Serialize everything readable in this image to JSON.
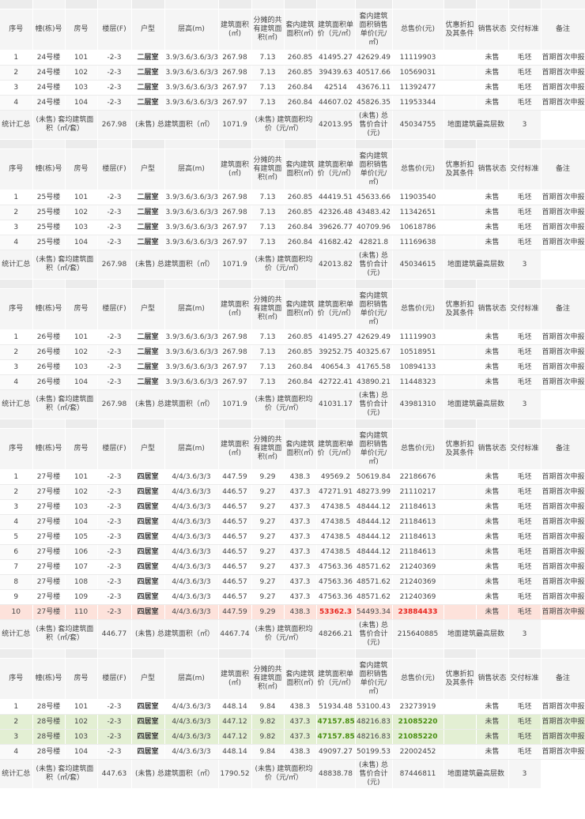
{
  "headers": [
    "序号",
    "幢(栋)号",
    "房号",
    "楼层(F)",
    "户型",
    "层高(m)",
    "建筑面积(㎡)",
    "分摊的共有建筑面积(㎡)",
    "套内建筑面积(㎡)",
    "建筑面积单价（元/㎡）",
    "套内建筑面积销售单价(元/㎡)",
    "总售价(元)",
    "优惠折扣及其条件",
    "销售状态",
    "交付标准",
    "备注"
  ],
  "summary_labels": {
    "title": "统计汇总",
    "avg_area": "(未售) 套均建筑面积（㎡/套）",
    "total_area": "(未售) 总建筑面积（㎡）",
    "avg_price": "(未售) 建筑面积均价（元/㎡）",
    "total_price": "(未售) 总售价合计(元)",
    "max_floors": "地面建筑最高层数"
  },
  "blocks": [
    {
      "rows": [
        {
          "no": "1",
          "bldg": "24号楼",
          "room": "101",
          "floor": "-2-3",
          "type": "二层室",
          "height": "3.9/3.6/3.6/3/3",
          "area": "267.98",
          "shared": "7.13",
          "inner": "260.85",
          "unit": "41495.27",
          "inner_unit": "42629.49",
          "total": "11119903",
          "discount": "",
          "status": "未售",
          "delivery": "毛坯",
          "note": "首期首次申报"
        },
        {
          "no": "2",
          "bldg": "24号楼",
          "room": "102",
          "floor": "-2-3",
          "type": "二层室",
          "height": "3.9/3.6/3.6/3/3",
          "area": "267.98",
          "shared": "7.13",
          "inner": "260.85",
          "unit": "39439.63",
          "inner_unit": "40517.66",
          "total": "10569031",
          "discount": "",
          "status": "未售",
          "delivery": "毛坯",
          "note": "首期首次申报"
        },
        {
          "no": "3",
          "bldg": "24号楼",
          "room": "103",
          "floor": "-2-3",
          "type": "二层室",
          "height": "3.9/3.6/3.6/3/3",
          "area": "267.97",
          "shared": "7.13",
          "inner": "260.84",
          "unit": "42514",
          "inner_unit": "43676.11",
          "total": "11392477",
          "discount": "",
          "status": "未售",
          "delivery": "毛坯",
          "note": "首期首次申报"
        },
        {
          "no": "4",
          "bldg": "24号楼",
          "room": "104",
          "floor": "-2-3",
          "type": "二层室",
          "height": "3.9/3.6/3.6/3/3",
          "area": "267.97",
          "shared": "7.13",
          "inner": "260.84",
          "unit": "44607.02",
          "inner_unit": "45826.35",
          "total": "11953344",
          "discount": "",
          "status": "未售",
          "delivery": "毛坯",
          "note": "首期首次申报"
        }
      ],
      "summary": {
        "avg_area": "267.98",
        "total_area": "1071.9",
        "avg_price": "42013.95",
        "total_price": "45034755",
        "max_floors": "3"
      }
    },
    {
      "rows": [
        {
          "no": "1",
          "bldg": "25号楼",
          "room": "101",
          "floor": "-2-3",
          "type": "二层室",
          "height": "3.9/3.6/3.6/3/3",
          "area": "267.98",
          "shared": "7.13",
          "inner": "260.85",
          "unit": "44419.51",
          "inner_unit": "45633.66",
          "total": "11903540",
          "discount": "",
          "status": "未售",
          "delivery": "毛坯",
          "note": "首期首次申报"
        },
        {
          "no": "2",
          "bldg": "25号楼",
          "room": "102",
          "floor": "-2-3",
          "type": "二层室",
          "height": "3.9/3.6/3.6/3/3",
          "area": "267.98",
          "shared": "7.13",
          "inner": "260.85",
          "unit": "42326.48",
          "inner_unit": "43483.42",
          "total": "11342651",
          "discount": "",
          "status": "未售",
          "delivery": "毛坯",
          "note": "首期首次申报"
        },
        {
          "no": "3",
          "bldg": "25号楼",
          "room": "103",
          "floor": "-2-3",
          "type": "二层室",
          "height": "3.9/3.6/3.6/3/3",
          "area": "267.97",
          "shared": "7.13",
          "inner": "260.84",
          "unit": "39626.77",
          "inner_unit": "40709.96",
          "total": "10618786",
          "discount": "",
          "status": "未售",
          "delivery": "毛坯",
          "note": "首期首次申报"
        },
        {
          "no": "4",
          "bldg": "25号楼",
          "room": "104",
          "floor": "-2-3",
          "type": "二层室",
          "height": "3.9/3.6/3.6/3/3",
          "area": "267.97",
          "shared": "7.13",
          "inner": "260.84",
          "unit": "41682.42",
          "inner_unit": "42821.8",
          "total": "11169638",
          "discount": "",
          "status": "未售",
          "delivery": "毛坯",
          "note": "首期首次申报"
        }
      ],
      "summary": {
        "avg_area": "267.98",
        "total_area": "1071.9",
        "avg_price": "42013.82",
        "total_price": "45034615",
        "max_floors": "3"
      }
    },
    {
      "rows": [
        {
          "no": "1",
          "bldg": "26号楼",
          "room": "101",
          "floor": "-2-3",
          "type": "二层室",
          "height": "3.9/3.6/3.6/3/3",
          "area": "267.98",
          "shared": "7.13",
          "inner": "260.85",
          "unit": "41495.27",
          "inner_unit": "42629.49",
          "total": "11119903",
          "discount": "",
          "status": "未售",
          "delivery": "毛坯",
          "note": "首期首次申报"
        },
        {
          "no": "2",
          "bldg": "26号楼",
          "room": "102",
          "floor": "-2-3",
          "type": "二层室",
          "height": "3.9/3.6/3.6/3/3",
          "area": "267.98",
          "shared": "7.13",
          "inner": "260.85",
          "unit": "39252.75",
          "inner_unit": "40325.67",
          "total": "10518951",
          "discount": "",
          "status": "未售",
          "delivery": "毛坯",
          "note": "首期首次申报"
        },
        {
          "no": "3",
          "bldg": "26号楼",
          "room": "103",
          "floor": "-2-3",
          "type": "二层室",
          "height": "3.9/3.6/3.6/3/3",
          "area": "267.97",
          "shared": "7.13",
          "inner": "260.84",
          "unit": "40654.3",
          "inner_unit": "41765.58",
          "total": "10894133",
          "discount": "",
          "status": "未售",
          "delivery": "毛坯",
          "note": "首期首次申报"
        },
        {
          "no": "4",
          "bldg": "26号楼",
          "room": "104",
          "floor": "-2-3",
          "type": "二层室",
          "height": "3.9/3.6/3.6/3/3",
          "area": "267.97",
          "shared": "7.13",
          "inner": "260.84",
          "unit": "42722.41",
          "inner_unit": "43890.21",
          "total": "11448323",
          "discount": "",
          "status": "未售",
          "delivery": "毛坯",
          "note": "首期首次申报"
        }
      ],
      "summary": {
        "avg_area": "267.98",
        "total_area": "1071.9",
        "avg_price": "41031.17",
        "total_price": "43981310",
        "max_floors": "3"
      }
    },
    {
      "rows": [
        {
          "no": "1",
          "bldg": "27号楼",
          "room": "101",
          "floor": "-2-3",
          "type": "四居室",
          "height": "4/4/3.6/3/3",
          "area": "447.59",
          "shared": "9.29",
          "inner": "438.3",
          "unit": "49569.2",
          "inner_unit": "50619.84",
          "total": "22186676",
          "discount": "",
          "status": "未售",
          "delivery": "毛坯",
          "note": "首期首次申报"
        },
        {
          "no": "2",
          "bldg": "27号楼",
          "room": "102",
          "floor": "-2-3",
          "type": "四居室",
          "height": "4/4/3.6/3/3",
          "area": "446.57",
          "shared": "9.27",
          "inner": "437.3",
          "unit": "47271.91",
          "inner_unit": "48273.99",
          "total": "21110217",
          "discount": "",
          "status": "未售",
          "delivery": "毛坯",
          "note": "首期首次申报"
        },
        {
          "no": "3",
          "bldg": "27号楼",
          "room": "103",
          "floor": "-2-3",
          "type": "四居室",
          "height": "4/4/3.6/3/3",
          "area": "446.57",
          "shared": "9.27",
          "inner": "437.3",
          "unit": "47438.5",
          "inner_unit": "48444.12",
          "total": "21184613",
          "discount": "",
          "status": "未售",
          "delivery": "毛坯",
          "note": "首期首次申报"
        },
        {
          "no": "4",
          "bldg": "27号楼",
          "room": "104",
          "floor": "-2-3",
          "type": "四居室",
          "height": "4/4/3.6/3/3",
          "area": "446.57",
          "shared": "9.27",
          "inner": "437.3",
          "unit": "47438.5",
          "inner_unit": "48444.12",
          "total": "21184613",
          "discount": "",
          "status": "未售",
          "delivery": "毛坯",
          "note": "首期首次申报"
        },
        {
          "no": "5",
          "bldg": "27号楼",
          "room": "105",
          "floor": "-2-3",
          "type": "四居室",
          "height": "4/4/3.6/3/3",
          "area": "446.57",
          "shared": "9.27",
          "inner": "437.3",
          "unit": "47438.5",
          "inner_unit": "48444.12",
          "total": "21184613",
          "discount": "",
          "status": "未售",
          "delivery": "毛坯",
          "note": "首期首次申报"
        },
        {
          "no": "6",
          "bldg": "27号楼",
          "room": "106",
          "floor": "-2-3",
          "type": "四居室",
          "height": "4/4/3.6/3/3",
          "area": "446.57",
          "shared": "9.27",
          "inner": "437.3",
          "unit": "47438.5",
          "inner_unit": "48444.12",
          "total": "21184613",
          "discount": "",
          "status": "未售",
          "delivery": "毛坯",
          "note": "首期首次申报"
        },
        {
          "no": "7",
          "bldg": "27号楼",
          "room": "107",
          "floor": "-2-3",
          "type": "四居室",
          "height": "4/4/3.6/3/3",
          "area": "446.57",
          "shared": "9.27",
          "inner": "437.3",
          "unit": "47563.36",
          "inner_unit": "48571.62",
          "total": "21240369",
          "discount": "",
          "status": "未售",
          "delivery": "毛坯",
          "note": "首期首次申报"
        },
        {
          "no": "8",
          "bldg": "27号楼",
          "room": "108",
          "floor": "-2-3",
          "type": "四居室",
          "height": "4/4/3.6/3/3",
          "area": "446.57",
          "shared": "9.27",
          "inner": "437.3",
          "unit": "47563.36",
          "inner_unit": "48571.62",
          "total": "21240369",
          "discount": "",
          "status": "未售",
          "delivery": "毛坯",
          "note": "首期首次申报"
        },
        {
          "no": "9",
          "bldg": "27号楼",
          "room": "109",
          "floor": "-2-3",
          "type": "四居室",
          "height": "4/4/3.6/3/3",
          "area": "446.57",
          "shared": "9.27",
          "inner": "437.3",
          "unit": "47563.36",
          "inner_unit": "48571.62",
          "total": "21240369",
          "discount": "",
          "status": "未售",
          "delivery": "毛坯",
          "note": "首期首次申报"
        },
        {
          "no": "10",
          "bldg": "27号楼",
          "room": "110",
          "floor": "-2-3",
          "type": "四居室",
          "height": "4/4/3.6/3/3",
          "area": "447.59",
          "shared": "9.29",
          "inner": "438.3",
          "unit": "53362.3",
          "inner_unit": "54493.34",
          "total": "23884433",
          "discount": "",
          "status": "未售",
          "delivery": "毛坯",
          "note": "首期首次申报",
          "highlight": "red"
        }
      ],
      "summary": {
        "avg_area": "446.77",
        "total_area": "4467.74",
        "avg_price": "48266.21",
        "total_price": "215640885",
        "max_floors": "3"
      }
    },
    {
      "rows": [
        {
          "no": "1",
          "bldg": "28号楼",
          "room": "101",
          "floor": "-2-3",
          "type": "四居室",
          "height": "4/4/3.6/3/3",
          "area": "448.14",
          "shared": "9.84",
          "inner": "438.3",
          "unit": "51934.48",
          "inner_unit": "53100.43",
          "total": "23273919",
          "discount": "",
          "status": "未售",
          "delivery": "毛坯",
          "note": "首期首次申报"
        },
        {
          "no": "2",
          "bldg": "28号楼",
          "room": "102",
          "floor": "-2-3",
          "type": "四居室",
          "height": "4/4/3.6/3/3",
          "area": "447.12",
          "shared": "9.82",
          "inner": "437.3",
          "unit": "47157.85",
          "inner_unit": "48216.83",
          "total": "21085220",
          "discount": "",
          "status": "未售",
          "delivery": "毛坯",
          "note": "首期首次申报",
          "highlight": "green"
        },
        {
          "no": "3",
          "bldg": "28号楼",
          "room": "103",
          "floor": "-2-3",
          "type": "四居室",
          "height": "4/4/3.6/3/3",
          "area": "447.12",
          "shared": "9.82",
          "inner": "437.3",
          "unit": "47157.85",
          "inner_unit": "48216.83",
          "total": "21085220",
          "discount": "",
          "status": "未售",
          "delivery": "毛坯",
          "note": "首期首次申报",
          "highlight": "green"
        },
        {
          "no": "4",
          "bldg": "28号楼",
          "room": "104",
          "floor": "-2-3",
          "type": "四居室",
          "height": "4/4/3.6/3/3",
          "area": "448.14",
          "shared": "9.84",
          "inner": "438.3",
          "unit": "49097.27",
          "inner_unit": "50199.53",
          "total": "22002452",
          "discount": "",
          "status": "未售",
          "delivery": "毛坯",
          "note": "首期首次申报"
        }
      ],
      "summary": {
        "avg_area": "447.63",
        "total_area": "1790.52",
        "avg_price": "48838.78",
        "total_price": "87446811",
        "max_floors": "3"
      }
    }
  ],
  "colors": {
    "highlight_red_bg": "#fde2db",
    "highlight_red_text": "#e8231c",
    "highlight_green_bg": "#e3efd3",
    "highlight_green_text": "#4a8f12"
  }
}
